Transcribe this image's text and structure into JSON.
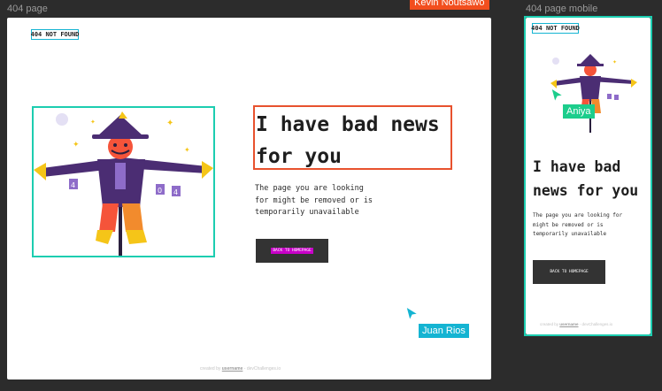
{
  "canvas": {
    "desktop_frame_label": "404 page",
    "mobile_frame_label": "404 page mobile",
    "top_user_tag": "Kevin Noutsawo"
  },
  "desktop": {
    "logo": "404 NOT FOUND",
    "headline_line1": "I have bad news",
    "headline_line2": "for you",
    "description_line1": "The page you are looking",
    "description_line2": "for might be removed or is",
    "description_line3": "temporarily unavailable",
    "button_label": "BACK TO HOMEPAGE",
    "footer_prefix": "created by",
    "footer_user": "username",
    "footer_suffix": "- devChallenges.io"
  },
  "mobile": {
    "logo": "404 NOT FOUND",
    "headline_line1": "I have bad",
    "headline_line2": "news for you",
    "description_line1": "The page you are looking for",
    "description_line2": "might be removed or is",
    "description_line3": "temporarily unavailable",
    "button_label": "BACK TO HOMEPAGE",
    "footer_prefix": "created by",
    "footer_user": "username",
    "footer_suffix": "- devChallenges.io"
  },
  "collaborators": {
    "desktop_cursor": "Juan Rios",
    "mobile_cursor": "Aniya"
  },
  "illustration_sign_text": [
    "4",
    "0",
    "4"
  ],
  "colors": {
    "canvas": "#2c2c2c",
    "selection_cyan": "#1ccdb0",
    "selection_blue": "#14b4d2",
    "selection_orange": "#e8522e",
    "user_tag_orange": "#f24e1e",
    "cursor_juan": "#14b4d2",
    "cursor_aniya": "#1ccd8c",
    "button_bg": "#333333",
    "button_label_bg": "#c800c8"
  }
}
